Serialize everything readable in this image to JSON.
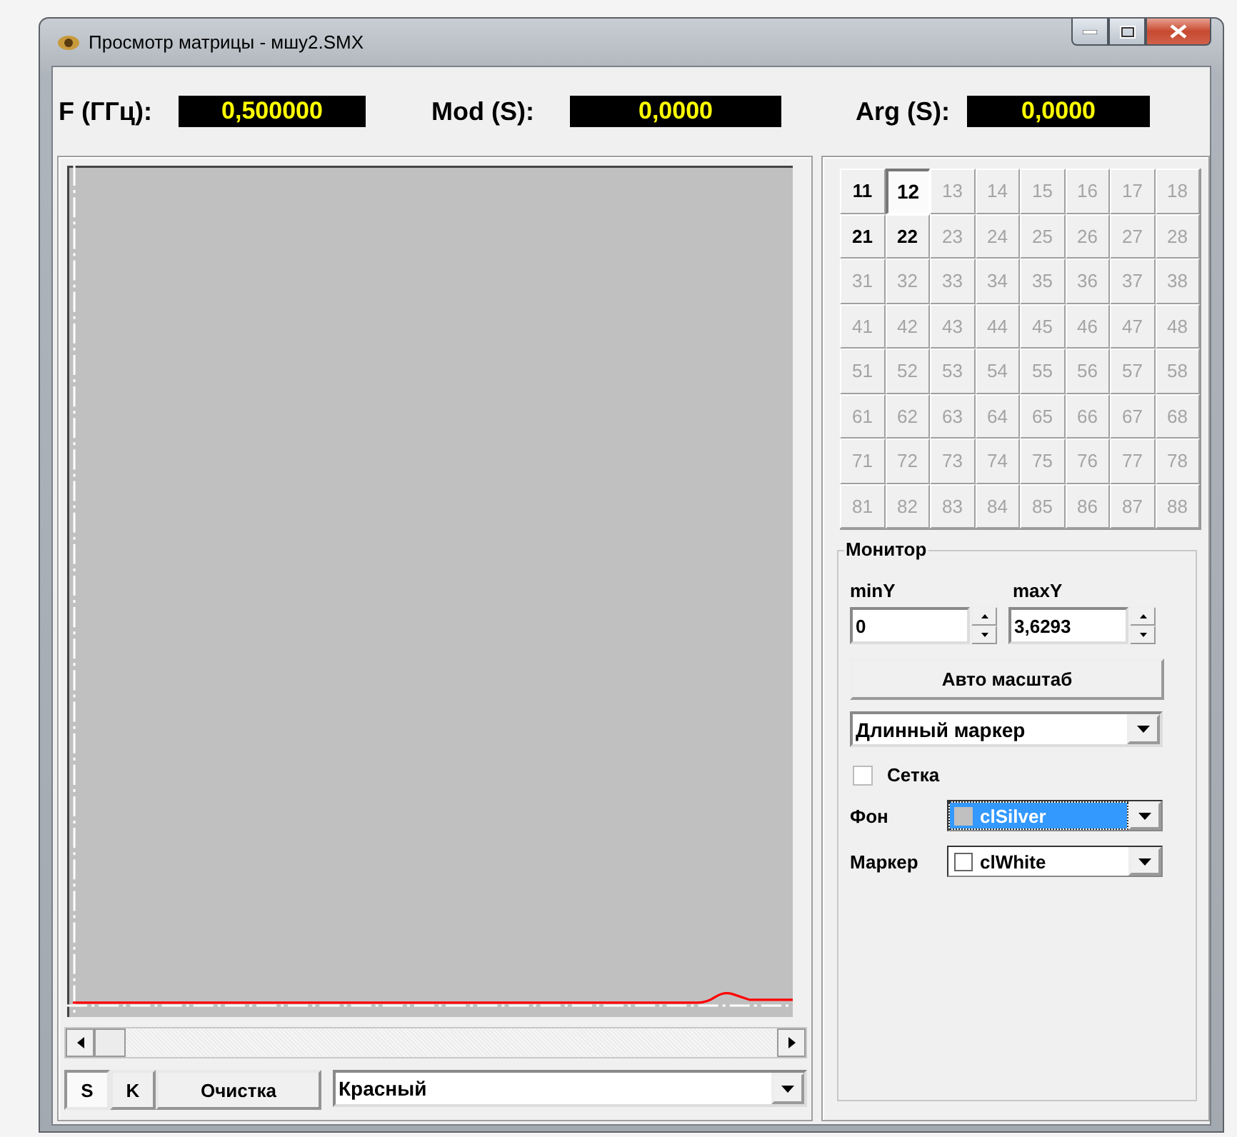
{
  "window": {
    "title": "Просмотр матрицы - мшу2.SMX"
  },
  "readouts": [
    {
      "label": "F (ГГц):",
      "value": "0,500000"
    },
    {
      "label": "Mod (S):",
      "value": "0,0000"
    },
    {
      "label": "Arg (S):",
      "value": "0,0000"
    }
  ],
  "matrix": {
    "rows": [
      [
        {
          "label": "11",
          "enabled": true,
          "selected": false
        },
        {
          "label": "12",
          "enabled": true,
          "selected": true
        },
        {
          "label": "13",
          "enabled": false,
          "selected": false
        },
        {
          "label": "14",
          "enabled": false,
          "selected": false
        },
        {
          "label": "15",
          "enabled": false,
          "selected": false
        },
        {
          "label": "16",
          "enabled": false,
          "selected": false
        },
        {
          "label": "17",
          "enabled": false,
          "selected": false
        },
        {
          "label": "18",
          "enabled": false,
          "selected": false
        }
      ],
      [
        {
          "label": "21",
          "enabled": true,
          "selected": false
        },
        {
          "label": "22",
          "enabled": true,
          "selected": false
        },
        {
          "label": "23",
          "enabled": false,
          "selected": false
        },
        {
          "label": "24",
          "enabled": false,
          "selected": false
        },
        {
          "label": "25",
          "enabled": false,
          "selected": false
        },
        {
          "label": "26",
          "enabled": false,
          "selected": false
        },
        {
          "label": "27",
          "enabled": false,
          "selected": false
        },
        {
          "label": "28",
          "enabled": false,
          "selected": false
        }
      ],
      [
        {
          "label": "31",
          "enabled": false,
          "selected": false
        },
        {
          "label": "32",
          "enabled": false,
          "selected": false
        },
        {
          "label": "33",
          "enabled": false,
          "selected": false
        },
        {
          "label": "34",
          "enabled": false,
          "selected": false
        },
        {
          "label": "35",
          "enabled": false,
          "selected": false
        },
        {
          "label": "36",
          "enabled": false,
          "selected": false
        },
        {
          "label": "37",
          "enabled": false,
          "selected": false
        },
        {
          "label": "38",
          "enabled": false,
          "selected": false
        }
      ],
      [
        {
          "label": "41",
          "enabled": false,
          "selected": false
        },
        {
          "label": "42",
          "enabled": false,
          "selected": false
        },
        {
          "label": "43",
          "enabled": false,
          "selected": false
        },
        {
          "label": "44",
          "enabled": false,
          "selected": false
        },
        {
          "label": "45",
          "enabled": false,
          "selected": false
        },
        {
          "label": "46",
          "enabled": false,
          "selected": false
        },
        {
          "label": "47",
          "enabled": false,
          "selected": false
        },
        {
          "label": "48",
          "enabled": false,
          "selected": false
        }
      ],
      [
        {
          "label": "51",
          "enabled": false,
          "selected": false
        },
        {
          "label": "52",
          "enabled": false,
          "selected": false
        },
        {
          "label": "53",
          "enabled": false,
          "selected": false
        },
        {
          "label": "54",
          "enabled": false,
          "selected": false
        },
        {
          "label": "55",
          "enabled": false,
          "selected": false
        },
        {
          "label": "56",
          "enabled": false,
          "selected": false
        },
        {
          "label": "57",
          "enabled": false,
          "selected": false
        },
        {
          "label": "58",
          "enabled": false,
          "selected": false
        }
      ],
      [
        {
          "label": "61",
          "enabled": false,
          "selected": false
        },
        {
          "label": "62",
          "enabled": false,
          "selected": false
        },
        {
          "label": "63",
          "enabled": false,
          "selected": false
        },
        {
          "label": "64",
          "enabled": false,
          "selected": false
        },
        {
          "label": "65",
          "enabled": false,
          "selected": false
        },
        {
          "label": "66",
          "enabled": false,
          "selected": false
        },
        {
          "label": "67",
          "enabled": false,
          "selected": false
        },
        {
          "label": "68",
          "enabled": false,
          "selected": false
        }
      ],
      [
        {
          "label": "71",
          "enabled": false,
          "selected": false
        },
        {
          "label": "72",
          "enabled": false,
          "selected": false
        },
        {
          "label": "73",
          "enabled": false,
          "selected": false
        },
        {
          "label": "74",
          "enabled": false,
          "selected": false
        },
        {
          "label": "75",
          "enabled": false,
          "selected": false
        },
        {
          "label": "76",
          "enabled": false,
          "selected": false
        },
        {
          "label": "77",
          "enabled": false,
          "selected": false
        },
        {
          "label": "78",
          "enabled": false,
          "selected": false
        }
      ],
      [
        {
          "label": "81",
          "enabled": false,
          "selected": false
        },
        {
          "label": "82",
          "enabled": false,
          "selected": false
        },
        {
          "label": "83",
          "enabled": false,
          "selected": false
        },
        {
          "label": "84",
          "enabled": false,
          "selected": false
        },
        {
          "label": "85",
          "enabled": false,
          "selected": false
        },
        {
          "label": "86",
          "enabled": false,
          "selected": false
        },
        {
          "label": "87",
          "enabled": false,
          "selected": false
        },
        {
          "label": "88",
          "enabled": false,
          "selected": false
        }
      ]
    ]
  },
  "monitor": {
    "title": "Монитор",
    "min_label": "minY",
    "min_value": "0",
    "max_label": "maxY",
    "max_value": "3,6293",
    "auto_button": "Авто масштаб",
    "marker_style": "Длинный маркер",
    "grid": {
      "label": "Сетка",
      "checked": false
    },
    "background": {
      "label": "Фон",
      "value": "clSilver",
      "color": "#c0c0c0",
      "focused": true
    },
    "marker": {
      "label": "Маркер",
      "value": "clWhite",
      "color": "#ffffff",
      "focused": false
    }
  },
  "bottom": {
    "buttons": [
      {
        "label": "S",
        "selected": true
      },
      {
        "label": "K",
        "selected": false
      }
    ],
    "clear_button": "Очистка",
    "trace_color": "Красный"
  }
}
